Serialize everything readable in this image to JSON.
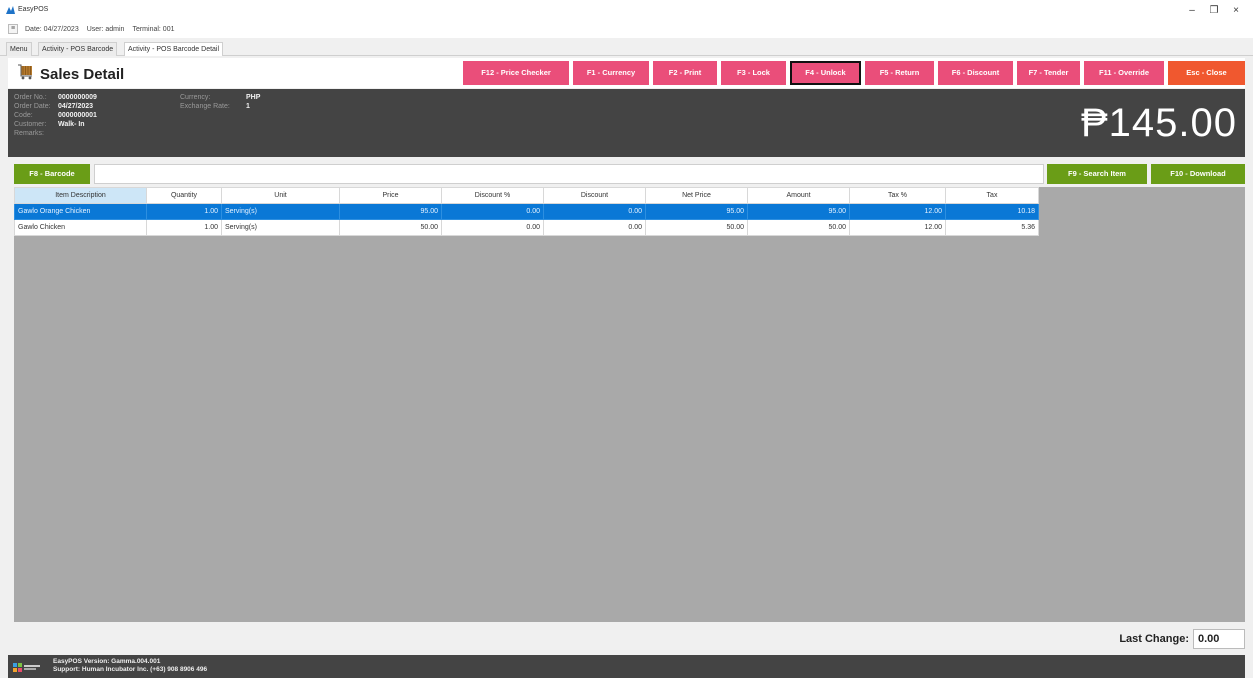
{
  "app": {
    "name": "EasyPOS",
    "session": {
      "date": "Date: 04/27/2023",
      "user": "User: admin",
      "terminal": "Terminal: 001"
    },
    "window_controls": {
      "minimize": "–",
      "restore": "❐",
      "close": "×"
    }
  },
  "tabs": [
    {
      "label": "Menu"
    },
    {
      "label": "Activity - POS Barcode"
    },
    {
      "label": "Activity - POS Barcode Detail"
    }
  ],
  "header": {
    "title": "Sales Detail",
    "function_buttons": [
      {
        "label": "F12 - Price Checker"
      },
      {
        "label": "F1 - Currency"
      },
      {
        "label": "F2 - Print"
      },
      {
        "label": "F3 - Lock"
      },
      {
        "label": "F4 - Unlock"
      },
      {
        "label": "F5 - Return"
      },
      {
        "label": "F6 - Discount"
      },
      {
        "label": "F7 - Tender"
      },
      {
        "label": "F11 - Override"
      },
      {
        "label": "Esc - Close"
      }
    ],
    "colors": {
      "function_button": "#ea4e7a",
      "close_button": "#f0582f",
      "action_button": "#6a9d17",
      "selected_row": "#0a78d6"
    }
  },
  "info": {
    "order_no_label": "Order No.:",
    "order_no": "0000000009",
    "order_date_label": "Order Date:",
    "order_date": "04/27/2023",
    "code_label": "Code:",
    "code": "0000000001",
    "customer_label": "Customer:",
    "customer": "Walk- In",
    "remarks_label": "Remarks:",
    "currency_label": "Currency:",
    "currency": "PHP",
    "exchange_label": "Exchange Rate:",
    "exchange": "1",
    "total": "₱145.00"
  },
  "actions": {
    "barcode": "F8 - Barcode",
    "search_item": "F9 - Search Item",
    "download": "F10 - Download"
  },
  "table": {
    "columns": [
      "Item Description",
      "Quantity",
      "Unit",
      "Price",
      "Discount %",
      "Discount",
      "Net Price",
      "Amount",
      "Tax %",
      "Tax"
    ],
    "rows": [
      [
        "Gawlo Orange Chicken",
        "1.00",
        "Serving(s)",
        "95.00",
        "0.00",
        "0.00",
        "95.00",
        "95.00",
        "12.00",
        "10.18"
      ],
      [
        "Gawlo Chicken",
        "1.00",
        "Serving(s)",
        "50.00",
        "0.00",
        "0.00",
        "50.00",
        "50.00",
        "12.00",
        "5.36"
      ]
    ]
  },
  "last_change": {
    "label": "Last Change:",
    "value": "0.00"
  },
  "footer": {
    "version": "EasyPOS Version: Gamma.004.001",
    "support": "Support: Human Incubator Inc. (+63) 908 8906 496"
  }
}
